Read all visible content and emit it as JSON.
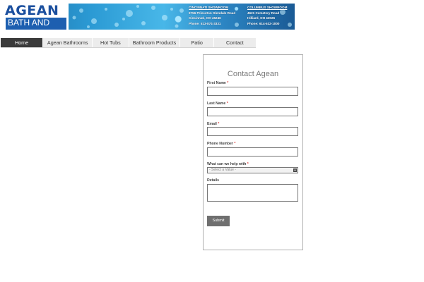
{
  "banner": {
    "logo_main": "AGEAN",
    "logo_sub": "BATH AND SPA",
    "showrooms": [
      {
        "heading": "CINCINNATI SHOWROOM",
        "address": "9756 Princeton Glendale Road",
        "city": "Cincinnati, OH 45246",
        "phone": "Phone: 513-874-3331"
      },
      {
        "heading": "COLUMBUS SHOWROOM",
        "address": "4621 Cemetery Road",
        "city": "Hilliard, OH 43026",
        "phone": "Phone: 614-532-1000"
      }
    ]
  },
  "nav": {
    "items": [
      {
        "label": "Home",
        "active": true
      },
      {
        "label": "Agean Bathrooms",
        "active": false
      },
      {
        "label": "Hot Tubs",
        "active": false
      },
      {
        "label": "Bathroom Products",
        "active": false
      },
      {
        "label": "Patio",
        "active": false
      },
      {
        "label": "Contact",
        "active": false
      }
    ]
  },
  "contact": {
    "title": "Contact Agean",
    "fields": {
      "first_name": {
        "label": "First Name",
        "required": "*",
        "value": ""
      },
      "last_name": {
        "label": "Last Name",
        "required": "*",
        "value": ""
      },
      "email": {
        "label": "Email",
        "required": "*",
        "value": ""
      },
      "phone": {
        "label": "Phone Number",
        "required": "*",
        "value": ""
      },
      "help": {
        "label": "What can we help with",
        "required": "*",
        "selected": "- Select a Value -"
      },
      "details": {
        "label": "Details",
        "value": ""
      }
    },
    "submit_label": "Submit"
  },
  "colors": {
    "nav_active_bg": "#3a3a3a",
    "nav_bg": "#ececec",
    "logo_blue": "#1b4f9e",
    "submit_bg": "#6f6f6f"
  }
}
